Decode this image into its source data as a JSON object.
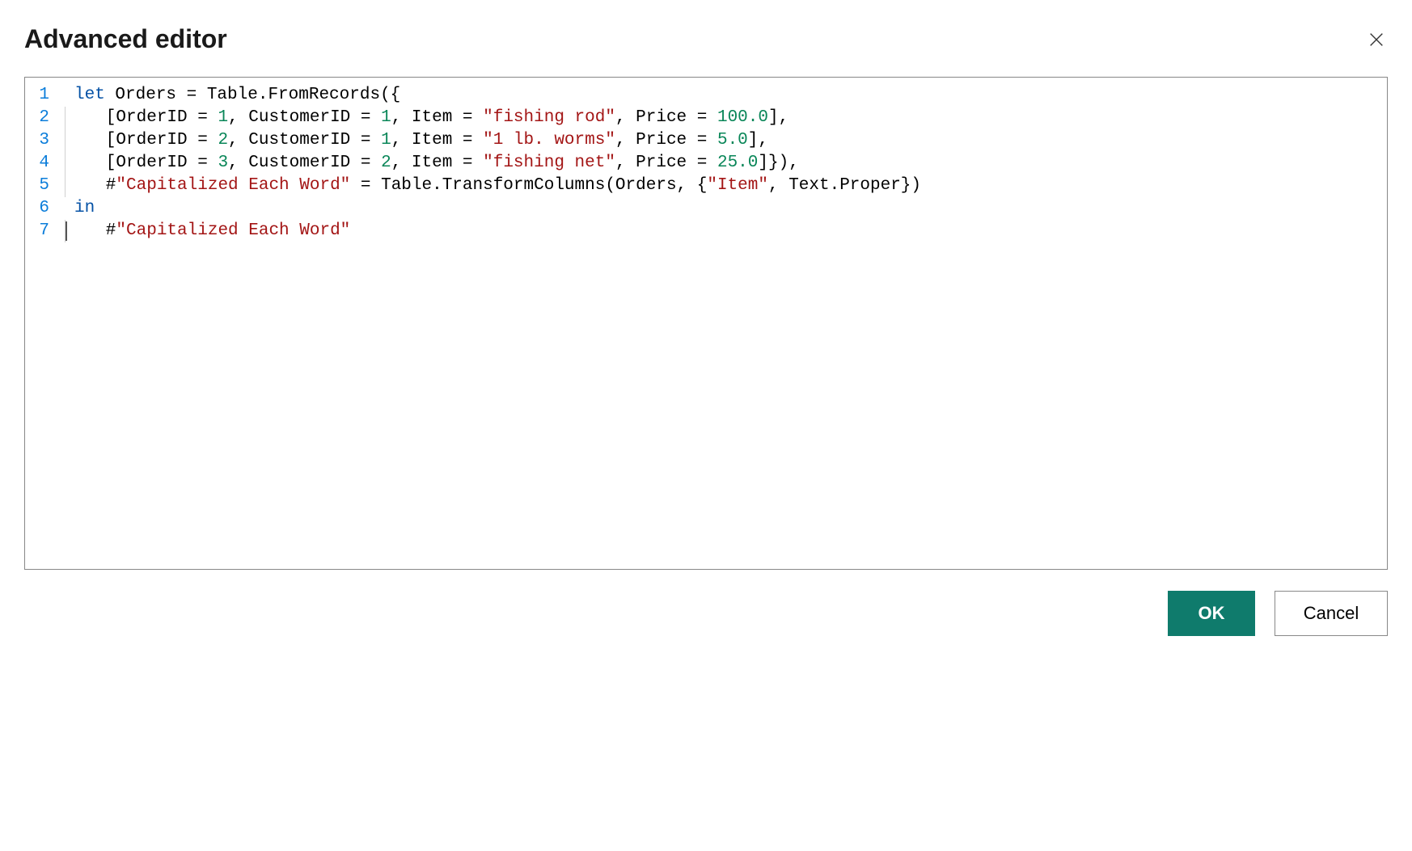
{
  "dialog": {
    "title": "Advanced editor",
    "ok_label": "OK",
    "cancel_label": "Cancel"
  },
  "editor": {
    "lines": [
      {
        "num": "1",
        "indent": false,
        "tokens": [
          {
            "t": "let",
            "c": "kw"
          },
          {
            "t": " Orders = Table.FromRecords({",
            "c": ""
          }
        ]
      },
      {
        "num": "2",
        "indent": true,
        "tokens": [
          {
            "t": "   [OrderID = ",
            "c": ""
          },
          {
            "t": "1",
            "c": "num"
          },
          {
            "t": ", CustomerID = ",
            "c": ""
          },
          {
            "t": "1",
            "c": "num"
          },
          {
            "t": ", Item = ",
            "c": ""
          },
          {
            "t": "\"fishing rod\"",
            "c": "str"
          },
          {
            "t": ", Price = ",
            "c": ""
          },
          {
            "t": "100.0",
            "c": "num"
          },
          {
            "t": "],",
            "c": ""
          }
        ]
      },
      {
        "num": "3",
        "indent": true,
        "tokens": [
          {
            "t": "   [OrderID = ",
            "c": ""
          },
          {
            "t": "2",
            "c": "num"
          },
          {
            "t": ", CustomerID = ",
            "c": ""
          },
          {
            "t": "1",
            "c": "num"
          },
          {
            "t": ", Item = ",
            "c": ""
          },
          {
            "t": "\"1 lb. worms\"",
            "c": "str"
          },
          {
            "t": ", Price = ",
            "c": ""
          },
          {
            "t": "5.0",
            "c": "num"
          },
          {
            "t": "],",
            "c": ""
          }
        ]
      },
      {
        "num": "4",
        "indent": true,
        "tokens": [
          {
            "t": "   [OrderID = ",
            "c": ""
          },
          {
            "t": "3",
            "c": "num"
          },
          {
            "t": ", CustomerID = ",
            "c": ""
          },
          {
            "t": "2",
            "c": "num"
          },
          {
            "t": ", Item = ",
            "c": ""
          },
          {
            "t": "\"fishing net\"",
            "c": "str"
          },
          {
            "t": ", Price = ",
            "c": ""
          },
          {
            "t": "25.0",
            "c": "num"
          },
          {
            "t": "]}),",
            "c": ""
          }
        ]
      },
      {
        "num": "5",
        "indent": true,
        "tokens": [
          {
            "t": "   #",
            "c": ""
          },
          {
            "t": "\"Capitalized Each Word\"",
            "c": "str"
          },
          {
            "t": " = Table.TransformColumns(Orders, {",
            "c": ""
          },
          {
            "t": "\"Item\"",
            "c": "str"
          },
          {
            "t": ", Text.Proper})",
            "c": ""
          }
        ]
      },
      {
        "num": "6",
        "indent": false,
        "tokens": [
          {
            "t": "in",
            "c": "kw"
          }
        ]
      },
      {
        "num": "7",
        "indent": true,
        "cursor": true,
        "tokens": [
          {
            "t": "   #",
            "c": ""
          },
          {
            "t": "\"Capitalized Each Word\"",
            "c": "str"
          }
        ]
      }
    ]
  }
}
